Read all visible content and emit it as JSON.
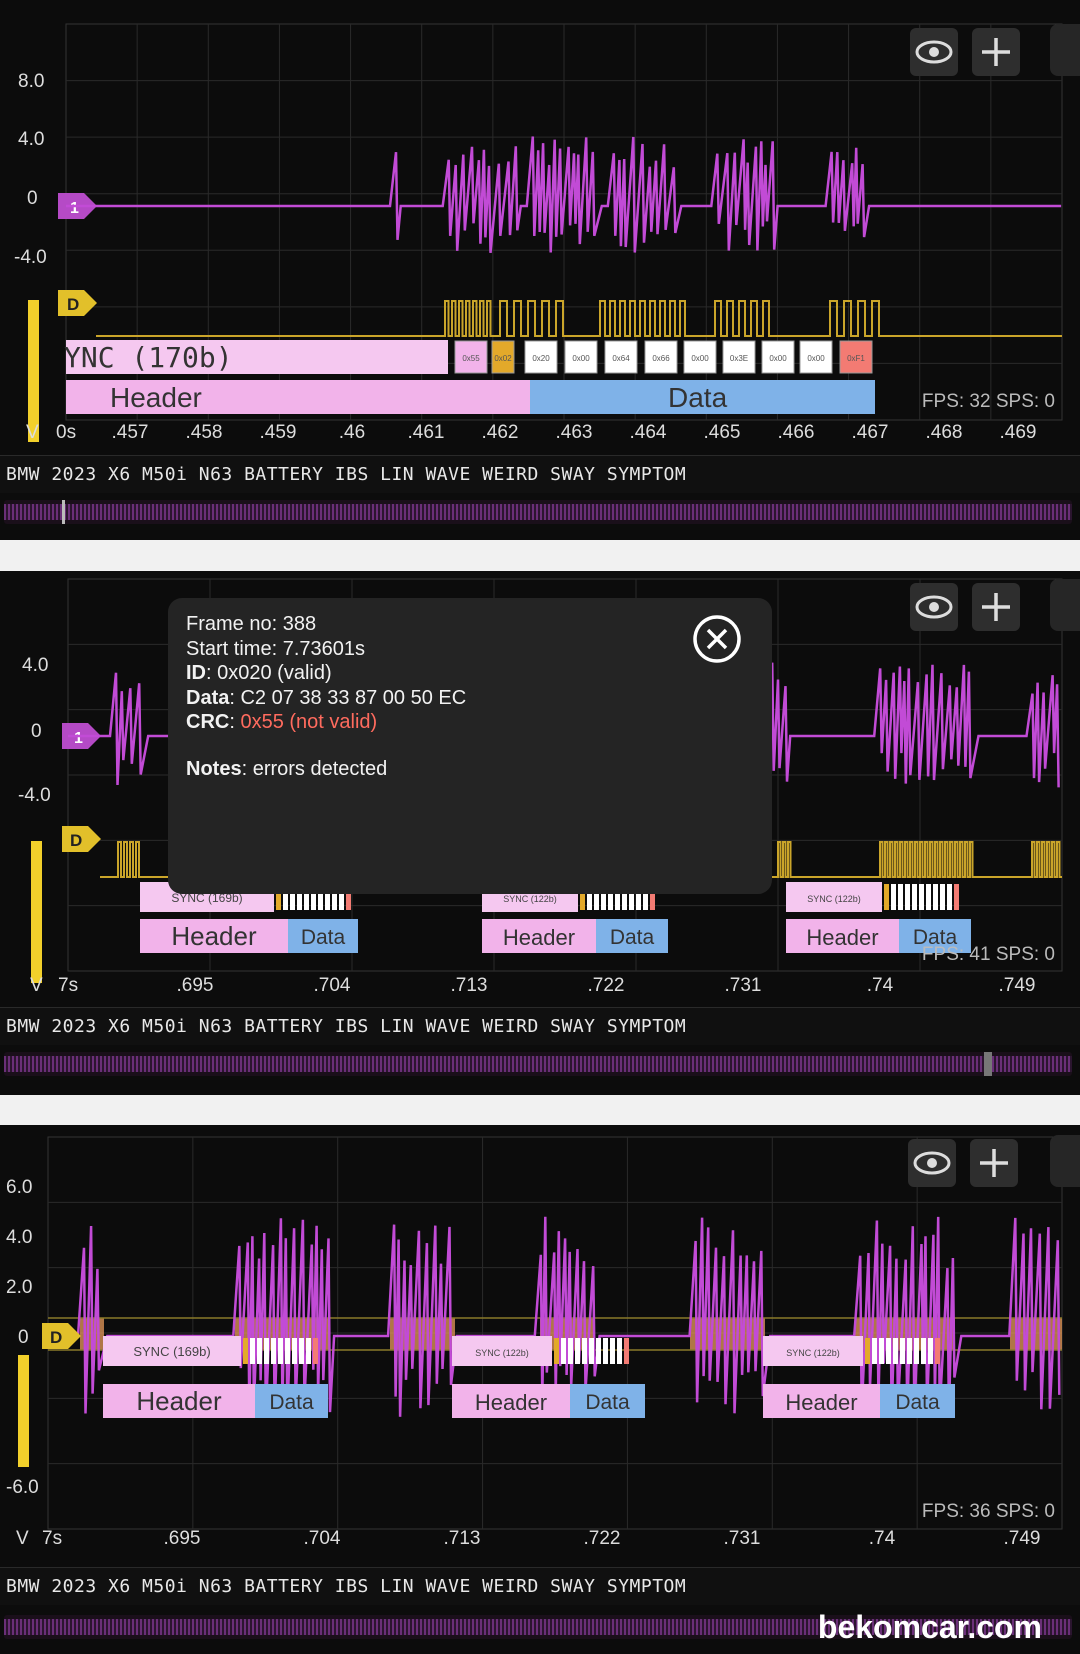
{
  "watermark": "bekomcar.com",
  "colors": {
    "signal": "#c24bd6",
    "decoder": "#d4b52a",
    "header": "#f2b3ea",
    "data": "#7fb2e8",
    "crc_error": "#ff6b5e"
  },
  "icons": {
    "visibility": "eye-icon",
    "add": "plus-icon",
    "close": "close-circle-icon"
  },
  "panels": [
    {
      "title": "BMW 2023 X6 M50i N63 BATTERY IBS LIN WAVE WEIRD SWAY SYMPTOM",
      "y_ticks": [
        "8.0",
        "4.0",
        "0",
        "-4.0"
      ],
      "x_ticks": [
        "0s",
        ".457",
        ".458",
        ".459",
        ".46",
        ".461",
        ".462",
        ".463",
        ".464",
        ".465",
        ".466",
        ".467",
        ".468",
        ".469"
      ],
      "axis_unit": "V",
      "channel_marker": "1",
      "decoder_marker": "D",
      "sync_label": "YNC (170b)",
      "bytes": [
        "0x55",
        "0x02",
        "0x20",
        "0x00",
        "0x64",
        "0x66",
        "0x00",
        "0x3E",
        "0x00",
        "0x00",
        "0xF1"
      ],
      "header_label": "Header",
      "data_label": "Data",
      "fps_label": "FPS: 32  SPS: 0"
    },
    {
      "title": "BMW 2023 X6 M50i N63 BATTERY IBS LIN WAVE WEIRD SWAY SYMPTOM",
      "y_ticks": [
        "4.0",
        "0",
        "-4.0"
      ],
      "x_ticks": [
        "7s",
        ".695",
        ".704",
        ".713",
        ".722",
        ".731",
        ".74",
        ".749"
      ],
      "axis_unit": "V",
      "channel_marker": "1",
      "decoder_marker": "D",
      "frames": [
        {
          "sync": "SYNC (169b)",
          "header": "Header",
          "data": "Data"
        },
        {
          "sync": "SYNC (122b)",
          "header": "Header",
          "data": "Data"
        },
        {
          "sync": "SYNC (122b)",
          "header": "Header",
          "data": "Data"
        }
      ],
      "fps_label": "FPS: 41  SPS: 0",
      "popup": {
        "frame_no": "Frame no: 388",
        "start_time": "Start time: 7.73601s",
        "id_label": "ID",
        "id_value": ": 0x020 (valid)",
        "data_label": "Data",
        "data_value": ": C2 07 38 33 87 00 50 EC",
        "crc_label": "CRC",
        "crc_value": "0x55 (not valid)",
        "notes_label": "Notes",
        "notes_value": ": errors detected"
      }
    },
    {
      "title": "BMW 2023 X6 M50i N63 BATTERY IBS LIN WAVE WEIRD SWAY SYMPTOM",
      "y_ticks": [
        "6.0",
        "4.0",
        "2.0",
        "0",
        "-6.0"
      ],
      "x_ticks": [
        "7s",
        ".695",
        ".704",
        ".713",
        ".722",
        ".731",
        ".74",
        ".749"
      ],
      "axis_unit": "V",
      "decoder_marker": "D",
      "frames": [
        {
          "sync": "SYNC (169b)",
          "header": "Header",
          "data": "Data"
        },
        {
          "sync": "SYNC (122b)",
          "header": "Header",
          "data": "Data"
        },
        {
          "sync": "SYNC (122b)",
          "header": "Header",
          "data": "Data"
        }
      ],
      "fps_label": "FPS: 36  SPS: 0"
    }
  ]
}
